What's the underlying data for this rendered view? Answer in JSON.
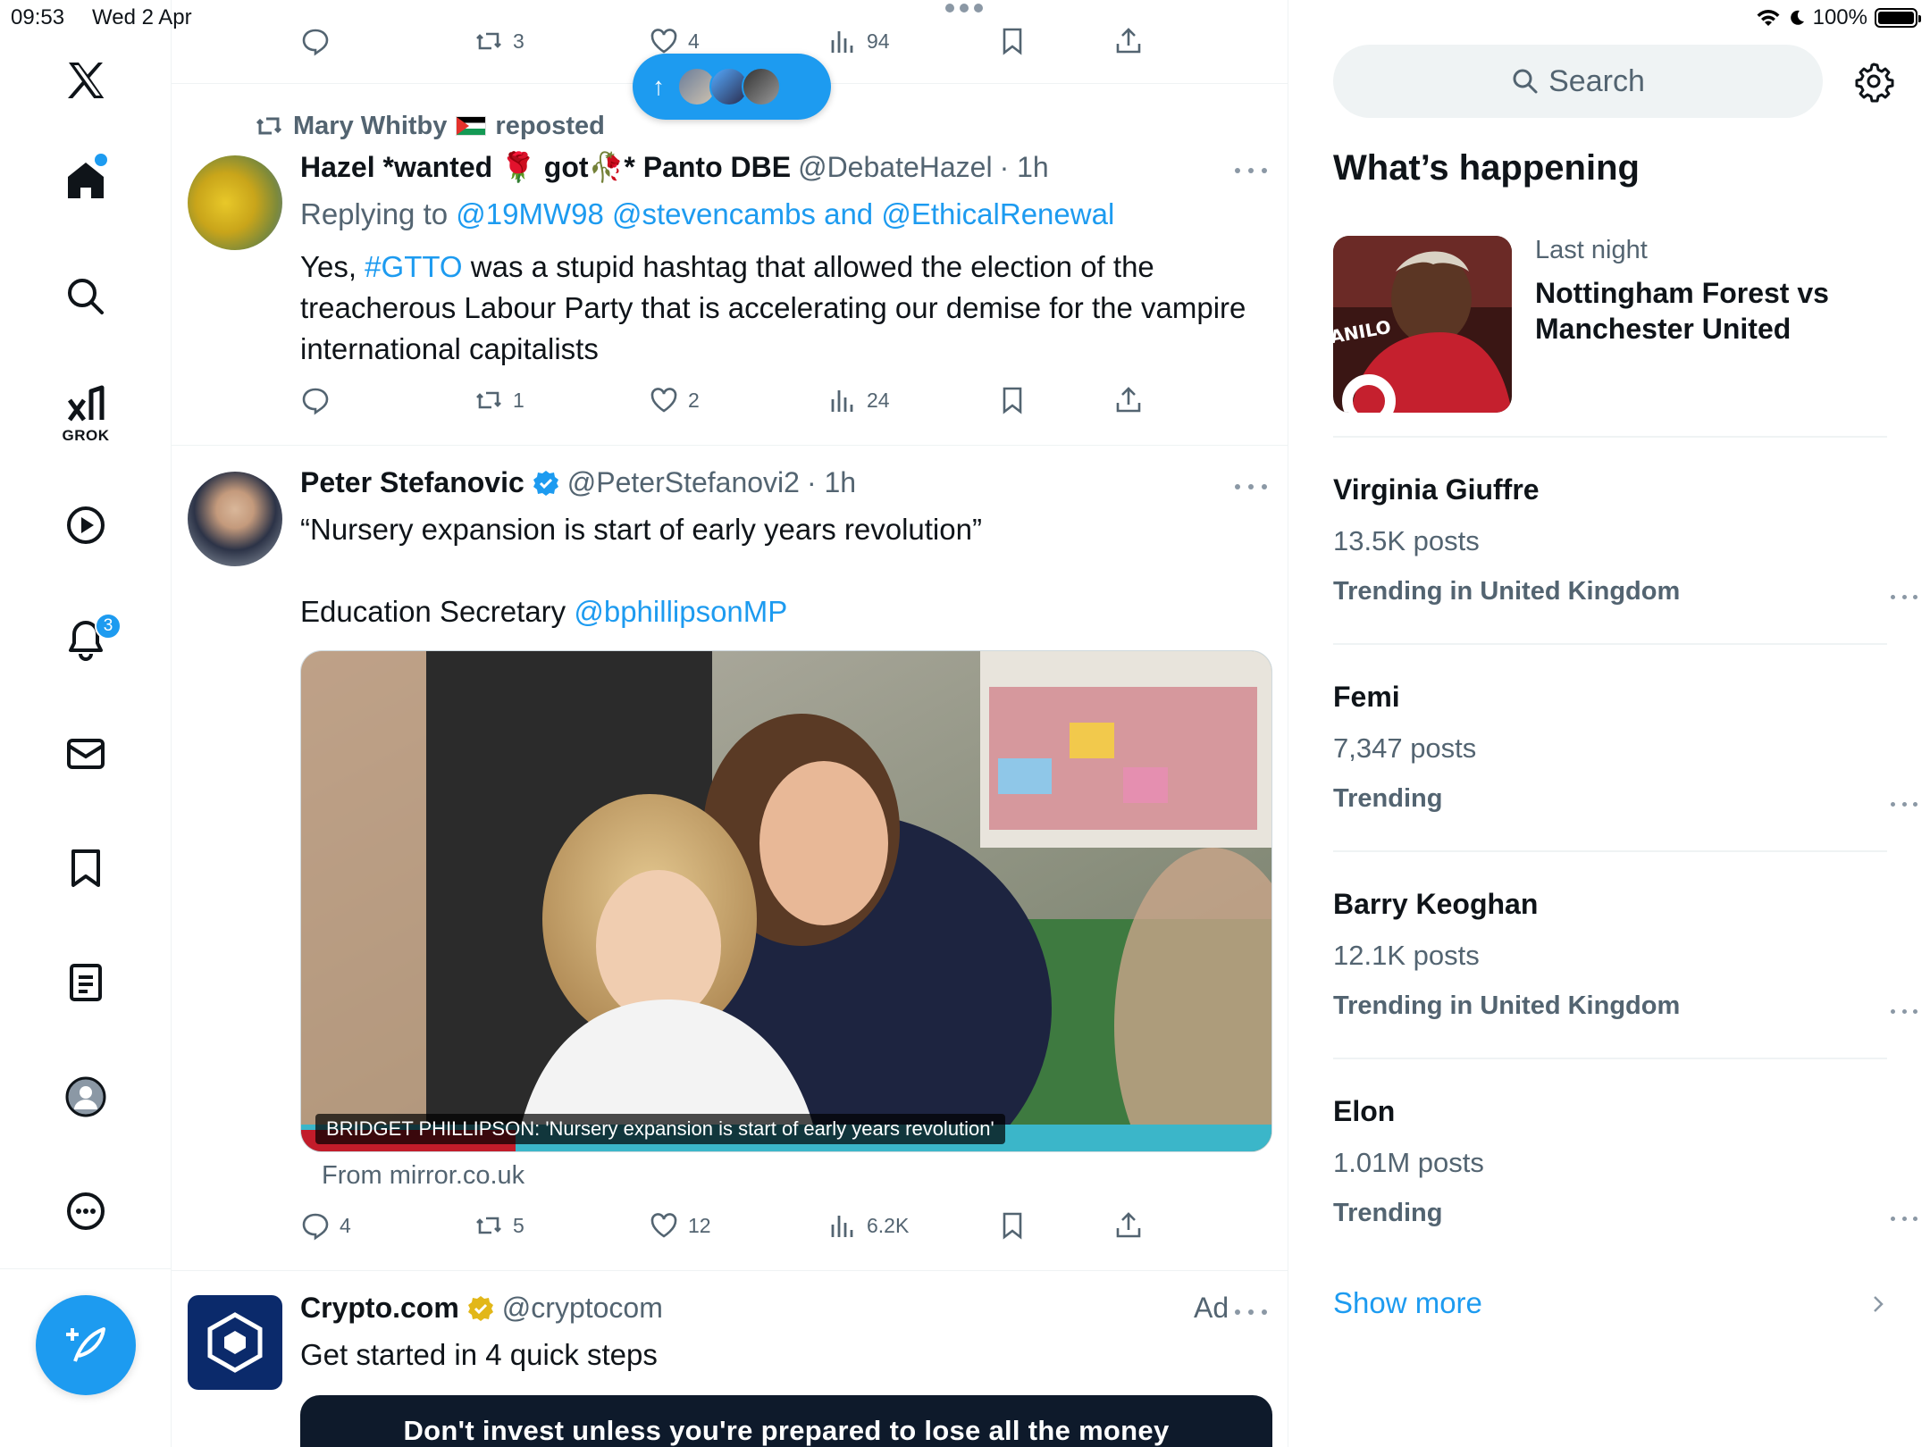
{
  "status_bar": {
    "time": "09:53",
    "date": "Wed 2 Apr",
    "battery": "100%"
  },
  "nav": {
    "grok_label": "GROK",
    "notifications_count": "3"
  },
  "new_posts_pill": {
    "arrow": "↑"
  },
  "feed": {
    "top_tweet_actions": {
      "retweets": "3",
      "likes": "4",
      "views": "94"
    },
    "repost": {
      "by": "Mary Whitby",
      "label": "reposted",
      "name": "Hazel *wanted 🌹 got🥀* Panto DBE",
      "handle": "@DebateHazel",
      "time": "· 1h",
      "replying_to_label": "Replying to",
      "replying_to": "@19MW98 @stevencambs and @EthicalRenewal",
      "text_prefix": "Yes, ",
      "hashtag": "#GTTO",
      "text_rest": " was a stupid hashtag that allowed the election of the treacherous Labour Party that is accelerating our demise for the vampire international capitalists",
      "actions": {
        "replies": "",
        "retweets": "1",
        "likes": "2",
        "views": "24"
      }
    },
    "tweet2": {
      "name": "Peter Stefanovic",
      "handle": "@PeterStefanovi2",
      "time": "· 1h",
      "line1": "“Nursery expansion is start of early years revolution”",
      "line2_prefix": "Education Secretary ",
      "line2_mention": "@bphillipsonMP",
      "media_caption": "BRIDGET PHILLIPSON: 'Nursery expansion is start of early years revolution'",
      "media_source": "From mirror.co.uk",
      "actions": {
        "replies": "4",
        "retweets": "5",
        "likes": "12",
        "views": "6.2K"
      }
    },
    "ad": {
      "name": "Crypto.com",
      "handle": "@cryptocom",
      "label": "Ad",
      "text": "Get started in 4 quick steps",
      "banner": "Don't invest unless you're prepared to lose all the money"
    }
  },
  "sidebar": {
    "search_placeholder": "Search",
    "section_title": "What’s happening",
    "event": {
      "meta": "Last night",
      "title": "Nottingham Forest vs Manchester United"
    },
    "trends": [
      {
        "name": "Virginia Giuffre",
        "posts": "13.5K posts",
        "context": "Trending in United Kingdom"
      },
      {
        "name": "Femi",
        "posts": "7,347 posts",
        "context": "Trending"
      },
      {
        "name": "Barry Keoghan",
        "posts": "12.1K posts",
        "context": "Trending in United Kingdom"
      },
      {
        "name": "Elon",
        "posts": "1.01M posts",
        "context": "Trending"
      }
    ],
    "show_more": "Show more"
  },
  "colors": {
    "accent": "#1d9bf0",
    "text": "#0f1419",
    "secondary": "#536471",
    "border": "#eff3f4"
  }
}
